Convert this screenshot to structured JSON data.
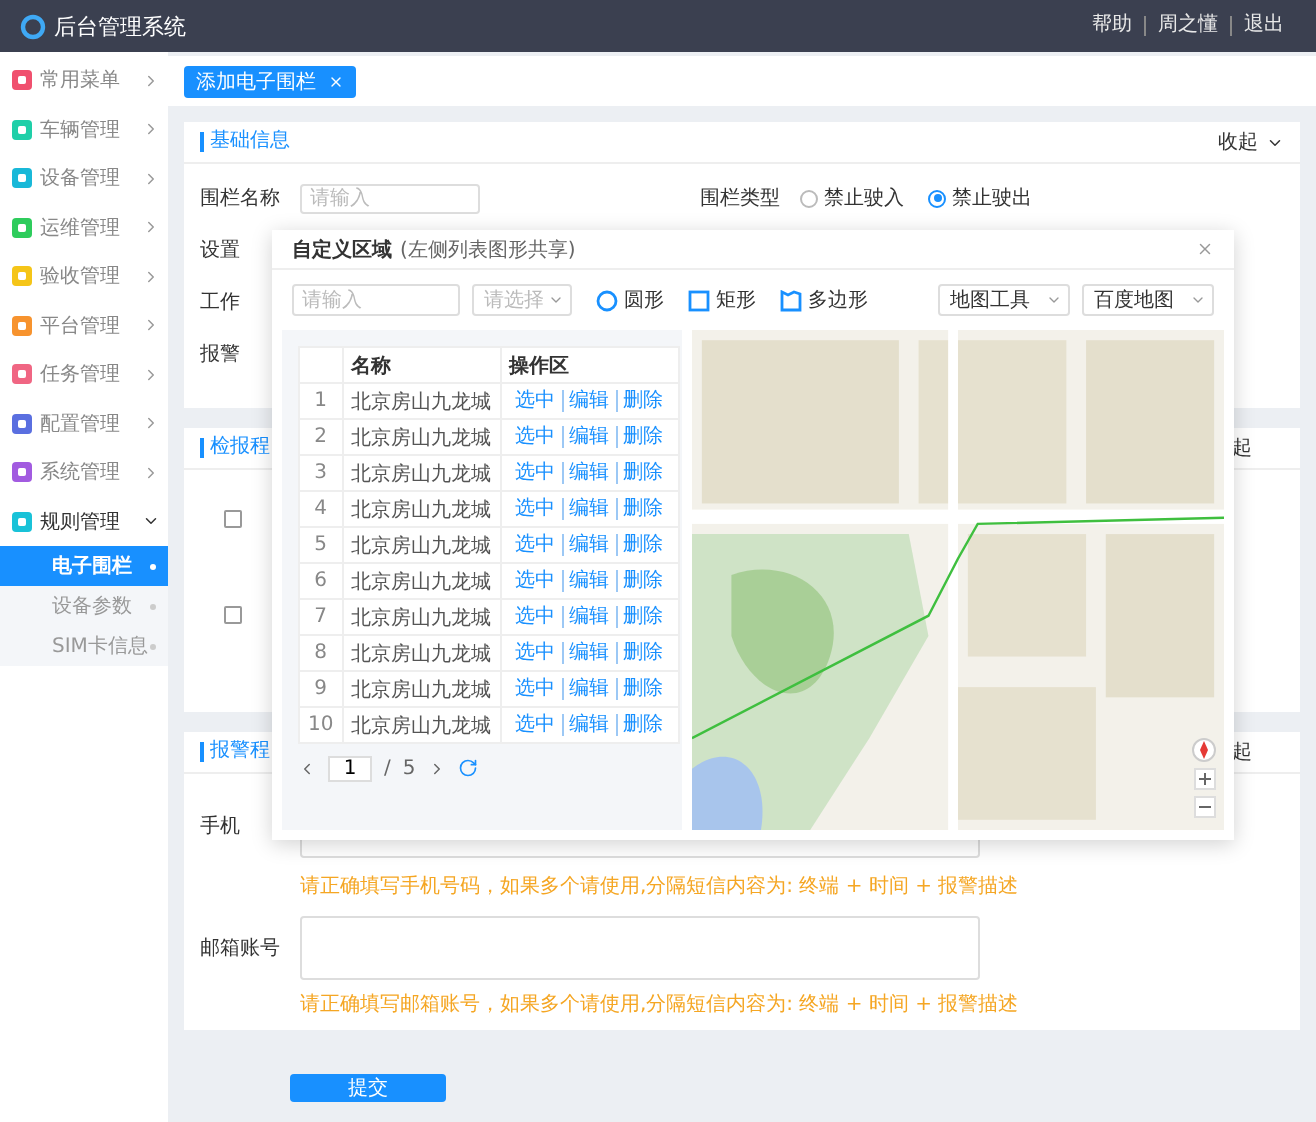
{
  "header": {
    "title": "后台管理系统",
    "links": [
      "帮助",
      "周之懂",
      "退出"
    ]
  },
  "sidebar": {
    "items": [
      {
        "label": "常用菜单",
        "color": "#f0506e",
        "expanded": false
      },
      {
        "label": "车辆管理",
        "color": "#1fcfa8",
        "expanded": false
      },
      {
        "label": "设备管理",
        "color": "#19b8d8",
        "expanded": false
      },
      {
        "label": "运维管理",
        "color": "#2ecc5c",
        "expanded": false
      },
      {
        "label": "验收管理",
        "color": "#f5c518",
        "expanded": false
      },
      {
        "label": "平台管理",
        "color": "#f7932e",
        "expanded": false
      },
      {
        "label": "任务管理",
        "color": "#f06683",
        "expanded": false
      },
      {
        "label": "配置管理",
        "color": "#5a6fe0",
        "expanded": false
      },
      {
        "label": "系统管理",
        "color": "#a25be0",
        "expanded": false
      },
      {
        "label": "规则管理",
        "color": "#19c2d8",
        "expanded": true,
        "children": [
          {
            "label": "电子围栏",
            "selected": true
          },
          {
            "label": "设备参数",
            "selected": false
          },
          {
            "label": "SIM卡信息",
            "selected": false
          }
        ]
      }
    ]
  },
  "tabs": [
    {
      "label": "添加电子围栏",
      "selected": true
    }
  ],
  "basic_section": {
    "title": "基础信息",
    "toggle": "收起",
    "name_field": {
      "label": "围栏名称",
      "placeholder": "请输入"
    },
    "type_field": {
      "label": "围栏类型",
      "options": [
        {
          "label": "禁止驶入",
          "selected": false
        },
        {
          "label": "禁止驶出",
          "selected": true
        }
      ]
    },
    "partial_labels": [
      "设置",
      "工作",
      "报警"
    ]
  },
  "check_section": {
    "title": "检报程",
    "toggle": "起",
    "checkboxes": [
      {
        "checked": false
      },
      {
        "checked": false
      }
    ]
  },
  "alarm_section": {
    "title": "报警程",
    "toggle": "起",
    "phone": {
      "label": "手机",
      "hint": "请正确填写手机号码，如果多个请使用,分隔短信内容为: 终端 + 时间 + 报警描述"
    },
    "email": {
      "label": "邮箱账号",
      "hint": "请正确填写邮箱账号，如果多个请使用,分隔短信内容为: 终端 + 时间 + 报警描述"
    }
  },
  "submit": "提交",
  "modal": {
    "title": "自定义区域",
    "subtitle": "(左侧列表图形共享)",
    "search_placeholder": "请输入",
    "select_placeholder": "请选择",
    "shapes": [
      {
        "kind": "circle",
        "label": "圆形"
      },
      {
        "kind": "rect",
        "label": "矩形"
      },
      {
        "kind": "polygon",
        "label": "多边形"
      }
    ],
    "map_tool": "地图工具",
    "map_type": "百度地图",
    "table": {
      "columns": [
        "名称",
        "操作区"
      ],
      "rows": [
        {
          "index": "1",
          "name": "北京房山九龙城",
          "actions": [
            "选中",
            "编辑",
            "删除"
          ]
        },
        {
          "index": "2",
          "name": "北京房山九龙城",
          "actions": [
            "选中",
            "编辑",
            "删除"
          ]
        },
        {
          "index": "3",
          "name": "北京房山九龙城",
          "actions": [
            "选中",
            "编辑",
            "删除"
          ]
        },
        {
          "index": "4",
          "name": "北京房山九龙城",
          "actions": [
            "选中",
            "编辑",
            "删除"
          ]
        },
        {
          "index": "5",
          "name": "北京房山九龙城",
          "actions": [
            "选中",
            "编辑",
            "删除"
          ]
        },
        {
          "index": "6",
          "name": "北京房山九龙城",
          "actions": [
            "选中",
            "编辑",
            "删除"
          ]
        },
        {
          "index": "7",
          "name": "北京房山九龙城",
          "actions": [
            "选中",
            "编辑",
            "删除"
          ]
        },
        {
          "index": "8",
          "name": "北京房山九龙城",
          "actions": [
            "选中",
            "编辑",
            "删除"
          ]
        },
        {
          "index": "9",
          "name": "北京房山九龙城",
          "actions": [
            "选中",
            "编辑",
            "删除"
          ]
        },
        {
          "index": "10",
          "name": "北京房山九龙城",
          "actions": [
            "选中",
            "编辑",
            "删除"
          ]
        }
      ]
    },
    "pagination": {
      "page": "1",
      "separator": "/",
      "total": "5"
    }
  }
}
